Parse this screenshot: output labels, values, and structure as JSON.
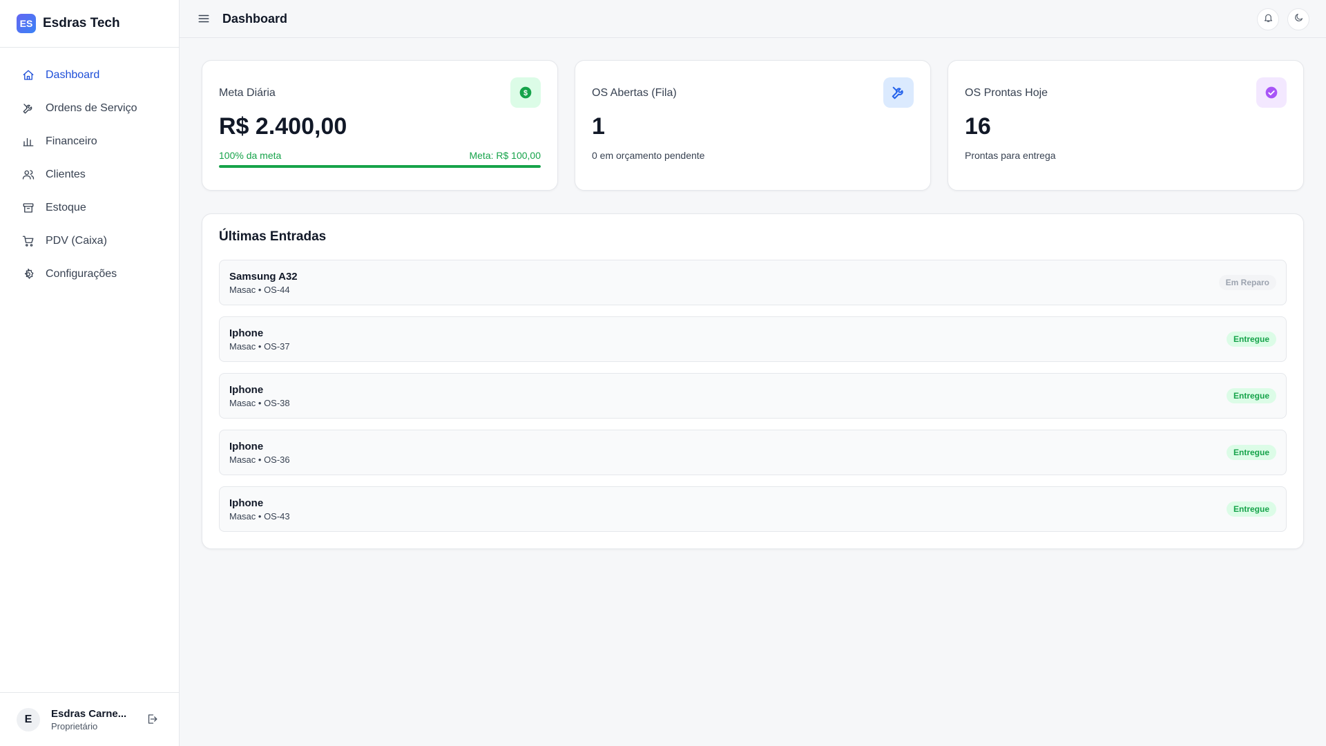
{
  "brand": {
    "logo": "ES",
    "name": "Esdras Tech"
  },
  "nav": {
    "items": [
      {
        "label": "Dashboard",
        "icon": "home-icon"
      },
      {
        "label": "Ordens de Serviço",
        "icon": "tools-icon"
      },
      {
        "label": "Financeiro",
        "icon": "bar-chart-icon"
      },
      {
        "label": "Clientes",
        "icon": "users-icon"
      },
      {
        "label": "Estoque",
        "icon": "archive-icon"
      },
      {
        "label": "PDV (Caixa)",
        "icon": "cart-icon"
      },
      {
        "label": "Configurações",
        "icon": "gear-icon"
      }
    ]
  },
  "user": {
    "initial": "E",
    "name": "Esdras Carne...",
    "role": "Proprietário"
  },
  "header": {
    "title": "Dashboard"
  },
  "cards": {
    "meta": {
      "title": "Meta Diária",
      "value": "R$ 2.400,00",
      "progress_label": "100% da meta",
      "target_label": "Meta: R$ 100,00",
      "progress": 1.0,
      "color": "#16a34a"
    },
    "abertas": {
      "title": "OS Abertas (Fila)",
      "value": "1",
      "sub": "0 em orçamento pendente",
      "color": "#3b82f6"
    },
    "prontas": {
      "title": "OS Prontas Hoje",
      "value": "16",
      "sub": "Prontas para entrega",
      "color": "#a855f7"
    }
  },
  "entries": {
    "title": "Últimas Entradas",
    "items": [
      {
        "name": "Samsung A32",
        "sub": "Masac • OS-44",
        "status": "Em Reparo"
      },
      {
        "name": "Iphone",
        "sub": "Masac • OS-37",
        "status": "Entregue"
      },
      {
        "name": "Iphone",
        "sub": "Masac • OS-38",
        "status": "Entregue"
      },
      {
        "name": "Iphone",
        "sub": "Masac • OS-36",
        "status": "Entregue"
      },
      {
        "name": "Iphone",
        "sub": "Masac • OS-43",
        "status": "Entregue"
      }
    ]
  }
}
